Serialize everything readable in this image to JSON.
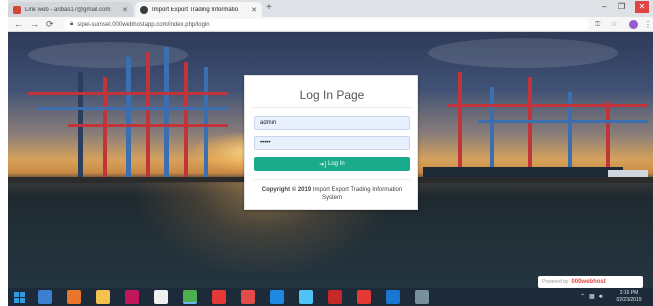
{
  "browser": {
    "tabs": [
      {
        "title": "Link web - aribas17@gmail.com",
        "active": false,
        "favicon_color": "#d44638"
      },
      {
        "title": "Import Export Trading Informatio",
        "active": true,
        "favicon_color": "#3a3a3a"
      }
    ],
    "new_tab_label": "+",
    "address": "sipei-sumsel.000webhostapp.com/index.php/login",
    "window_controls": {
      "minimize": "–",
      "maximize": "❐",
      "close": "✕"
    }
  },
  "login": {
    "title": "Log In Page",
    "username_value": "admin",
    "password_value": "•••••",
    "button_label": "Log In",
    "copyright_bold": "Copyright © 2019",
    "copyright_text": "Import Export Trading Information System",
    "accent_color": "#1aab8a"
  },
  "powered_by": {
    "prefix": "Powered by",
    "brand": "000webhost"
  },
  "taskbar": {
    "apps": [
      {
        "name": "explorer",
        "color": "#3c7fd1"
      },
      {
        "name": "firefox",
        "color": "#e8762c"
      },
      {
        "name": "files",
        "color": "#f2c14e"
      },
      {
        "name": "photos",
        "color": "#c2185b"
      },
      {
        "name": "notepad",
        "color": "#f0f0f0"
      },
      {
        "name": "chrome",
        "color": "#4caf50"
      },
      {
        "name": "opera",
        "color": "#e53935"
      },
      {
        "name": "vivaldi",
        "color": "#e34a4a"
      },
      {
        "name": "ie",
        "color": "#1e88e5"
      },
      {
        "name": "paint",
        "color": "#4fc3f7"
      },
      {
        "name": "matlab",
        "color": "#c62828"
      },
      {
        "name": "mail",
        "color": "#e53935"
      },
      {
        "name": "help",
        "color": "#1976d2"
      },
      {
        "name": "settings",
        "color": "#78909c"
      }
    ],
    "clock_time": "2:16 PM",
    "clock_date": "02/23/2019"
  }
}
